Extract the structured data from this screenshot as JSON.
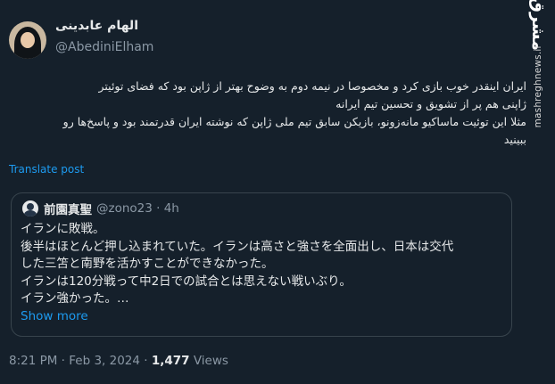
{
  "tweet": {
    "author_name": "الهام عابدینی",
    "author_handle": "@AbediniElham",
    "lines": [
      "ایران اینقدر خوب بازی کرد و  مخصوصا در نیمه دوم به وضوح بهتر از ژاپن بود که فضای توئیتر",
      "ژاپنی هم پر از تشویق و تحسین تیم ایرانه",
      "مثلا این توئیت ماساکیو مانه‌زونو، بازیکن سابق تیم ملی ژاپن که نوشته ایران قدرتمند بود و پاسخ‌ها رو",
      "ببینید"
    ],
    "translate_label": "Translate post"
  },
  "quoted": {
    "name": "前園真聖",
    "meta": "@zono23 · 4h",
    "lines": [
      "イランに敗戦。",
      "後半はほとんど押し込まれていた。イランは高さと強さを全面出し、日本は交代",
      "した三笘と南野を活かすことができなかった。",
      "イランは120分戦って中2日での試合とは思えない戦いぶり。",
      "イラン強かった。…"
    ],
    "show_more": "Show more"
  },
  "footer": {
    "timestamp": "8:21 PM · Feb 3, 2024 · ",
    "views_count": "1,477",
    "views_label": " Views"
  },
  "watermark": {
    "logo_text": "مشرق",
    "site": "mashreghnews.ir"
  }
}
